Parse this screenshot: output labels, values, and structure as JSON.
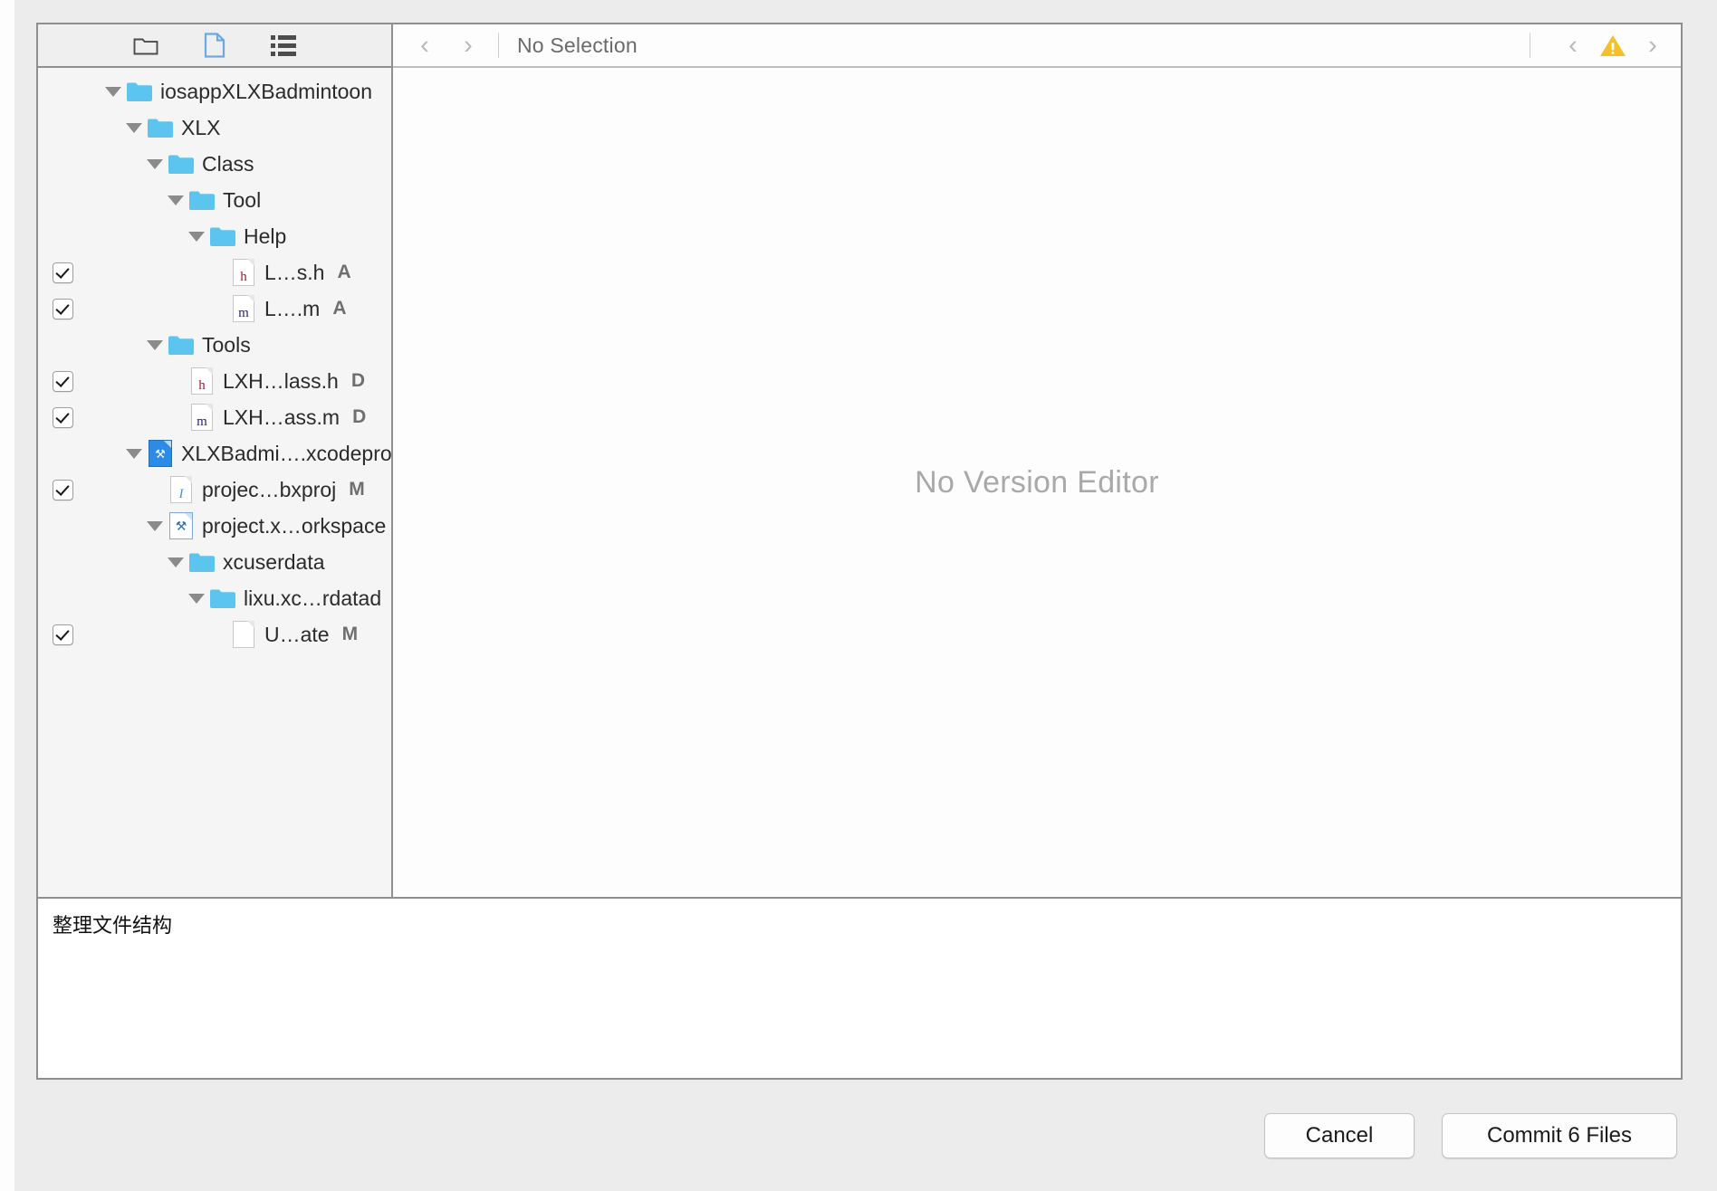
{
  "window": {
    "kind": "xcode-commit-dialog"
  },
  "toolbar": {
    "icons": [
      {
        "name": "folder-icon",
        "glyph": "folder",
        "selected": false
      },
      {
        "name": "document-icon",
        "glyph": "document",
        "selected": true
      },
      {
        "name": "list-icon",
        "glyph": "list",
        "selected": false
      }
    ]
  },
  "header": {
    "back_arrow": "‹",
    "forward_arrow": "›",
    "title": "No Selection",
    "issue_prev_arrow": "‹",
    "issue_next_arrow": "›",
    "warning_icon": "warning-triangle-icon",
    "warning_color": "#f5c02a"
  },
  "editor": {
    "empty_message": "No Version Editor"
  },
  "file_tree": {
    "rows": [
      {
        "id": "root",
        "depth": 0,
        "type": "folder",
        "expanded": true,
        "label": "iosappXLXBadmintoon",
        "status": "",
        "checkbox": null
      },
      {
        "id": "xlx",
        "depth": 1,
        "type": "folder",
        "expanded": true,
        "label": "XLX",
        "status": "",
        "checkbox": null
      },
      {
        "id": "class",
        "depth": 2,
        "type": "folder",
        "expanded": true,
        "label": "Class",
        "status": "",
        "checkbox": null
      },
      {
        "id": "tool",
        "depth": 3,
        "type": "folder",
        "expanded": true,
        "label": "Tool",
        "status": "",
        "checkbox": null
      },
      {
        "id": "help",
        "depth": 4,
        "type": "folder",
        "expanded": true,
        "label": "Help",
        "status": "",
        "checkbox": null
      },
      {
        "id": "lsh",
        "depth": 5,
        "type": "header",
        "expanded": null,
        "label": "L…s.h",
        "status": "A",
        "checkbox": true
      },
      {
        "id": "lm",
        "depth": 5,
        "type": "impl",
        "expanded": null,
        "label": "L….m",
        "status": "A",
        "checkbox": true
      },
      {
        "id": "tools",
        "depth": 2,
        "type": "folder",
        "expanded": true,
        "label": "Tools",
        "status": "",
        "checkbox": null
      },
      {
        "id": "lxhclassh",
        "depth": 3,
        "type": "header",
        "expanded": null,
        "label": "LXH…lass.h",
        "status": "D",
        "checkbox": true
      },
      {
        "id": "lxhclassm",
        "depth": 3,
        "type": "impl",
        "expanded": null,
        "label": "LXH…ass.m",
        "status": "D",
        "checkbox": true
      },
      {
        "id": "xcodeproj",
        "depth": 1,
        "type": "xcodeproj",
        "expanded": true,
        "label": "XLXBadmi….xcodeproj",
        "status": "",
        "checkbox": null
      },
      {
        "id": "pbxproj",
        "depth": 2,
        "type": "pbxproj",
        "expanded": null,
        "label": "projec…bxproj",
        "status": "M",
        "checkbox": true
      },
      {
        "id": "workspace",
        "depth": 2,
        "type": "workspace",
        "expanded": true,
        "label": "project.x…orkspace",
        "status": "",
        "checkbox": null
      },
      {
        "id": "xcuserdata",
        "depth": 3,
        "type": "folder",
        "expanded": true,
        "label": "xcuserdata",
        "status": "",
        "checkbox": null
      },
      {
        "id": "lixu",
        "depth": 4,
        "type": "folder",
        "expanded": true,
        "label": "lixu.xc…rdatad",
        "status": "",
        "checkbox": null
      },
      {
        "id": "ustate",
        "depth": 5,
        "type": "plain",
        "expanded": null,
        "label": "U…ate",
        "status": "M",
        "checkbox": true
      }
    ]
  },
  "commit_message": {
    "value": "整理文件结构",
    "placeholder": ""
  },
  "actions": {
    "cancel_label": "Cancel",
    "commit_label": "Commit 6 Files"
  },
  "colors": {
    "folder_blue": "#5bc4ef",
    "accent_blue": "#4a90d9",
    "warning_amber": "#f5c02a",
    "panel_border": "#8f8f8f",
    "sidebar_bg": "#f5f5f5"
  }
}
